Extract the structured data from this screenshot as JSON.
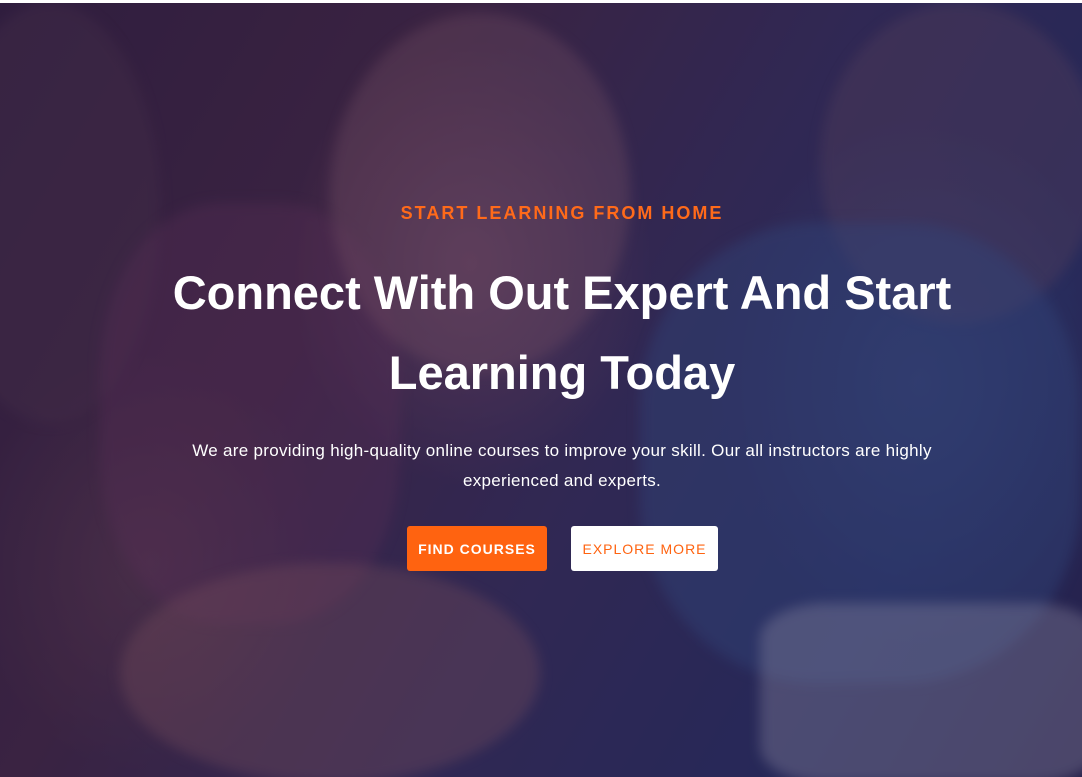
{
  "hero": {
    "eyebrow": "START LEARNING FROM HOME",
    "headline": "Connect With Out Expert And Start Learning Today",
    "subtext": "We are providing high-quality online courses to improve your skill. Our all instructors are highly experienced and experts.",
    "primary_button": "FIND COURSES",
    "secondary_button": "EXPLORE MORE"
  },
  "colors": {
    "accent": "#ff6310",
    "text_light": "#ffffff"
  }
}
